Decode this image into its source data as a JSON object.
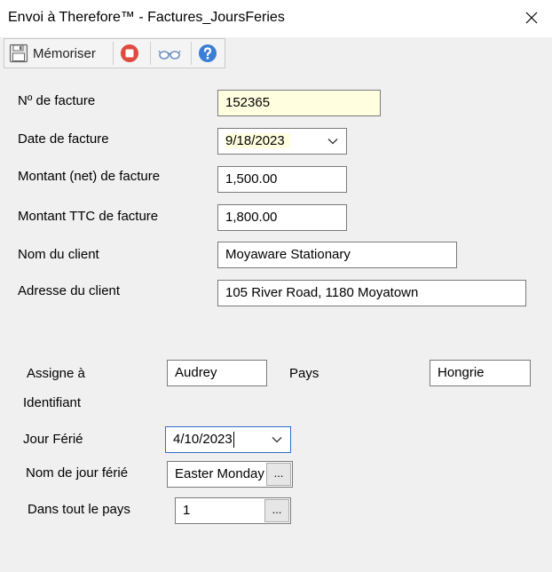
{
  "window": {
    "title": "Envoi à Therefore™ - Factures_JoursFeries"
  },
  "toolbar": {
    "save_label": "Mémoriser"
  },
  "form": {
    "invoice_no": {
      "label": "Nº de facture",
      "value": "152365"
    },
    "invoice_date": {
      "label": "Date de facture",
      "value": "9/18/2023"
    },
    "net_amount": {
      "label": "Montant (net) de facture",
      "value": "1,500.00"
    },
    "gross_amount": {
      "label": "Montant TTC de facture",
      "value": "1,800.00"
    },
    "client_name": {
      "label": "Nom du client",
      "value": "Moyaware Stationary"
    },
    "client_address": {
      "label": "Adresse du client",
      "value": "105 River Road, 1180 Moyatown"
    }
  },
  "holiday": {
    "assign": {
      "label": "Assigne à",
      "value": "Audrey"
    },
    "country": {
      "label": "Pays",
      "value": "Hongrie"
    },
    "identifier_label": "Identifiant",
    "date": {
      "label": "Jour Férié",
      "value": "4/10/2023"
    },
    "name": {
      "label": "Nom de jour férié",
      "value": "Easter Monday"
    },
    "nationwide": {
      "label": "Dans tout le pays",
      "value": "1"
    }
  },
  "icons": {
    "save": "floppy-disk-icon",
    "stop": "stop-icon",
    "view": "glasses-icon",
    "help": "help-icon",
    "close": "close-icon",
    "dropdown": "chevron-down-icon"
  },
  "colors": {
    "stop_red": "#e04a3f",
    "help_blue": "#3a7fd5",
    "required_field": "#ffffe0"
  }
}
